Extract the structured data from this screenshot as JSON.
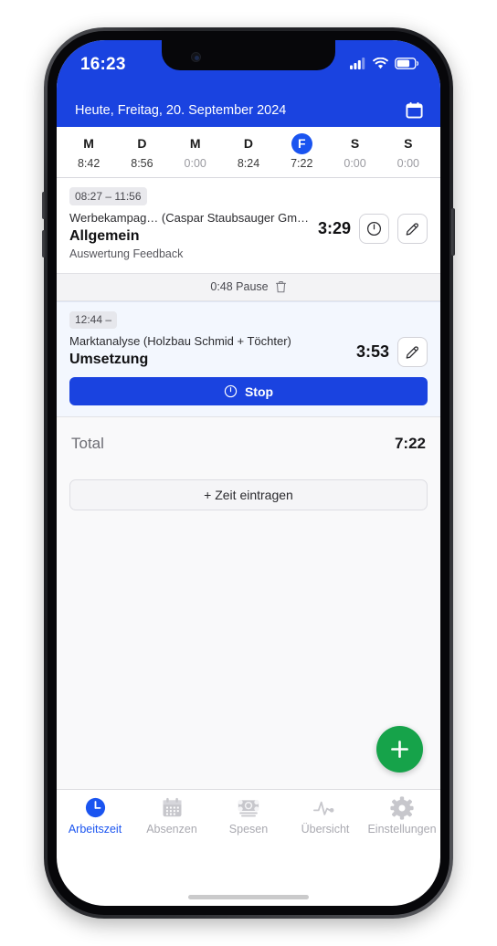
{
  "status_bar": {
    "time": "16:23",
    "icons": [
      "cellular-signal-icon",
      "wifi-icon",
      "battery-icon"
    ]
  },
  "header": {
    "title": "Heute, Freitag, 20. September 2024",
    "calendar_icon": "calendar-icon"
  },
  "week_strip": {
    "days": [
      {
        "letter": "M",
        "hours": "8:42",
        "active": false,
        "zero": false
      },
      {
        "letter": "D",
        "hours": "8:56",
        "active": false,
        "zero": false
      },
      {
        "letter": "M",
        "hours": "0:00",
        "active": false,
        "zero": true
      },
      {
        "letter": "D",
        "hours": "8:24",
        "active": false,
        "zero": false
      },
      {
        "letter": "F",
        "hours": "7:22",
        "active": true,
        "zero": false
      },
      {
        "letter": "S",
        "hours": "0:00",
        "active": false,
        "zero": true
      },
      {
        "letter": "S",
        "hours": "0:00",
        "active": false,
        "zero": true
      }
    ]
  },
  "entries": [
    {
      "time_range": "08:27 – 11:56",
      "project": "Werbekampag… (Caspar Staubsauger Gm…",
      "task": "Allgemein",
      "note": "Auswertung Feedback",
      "duration": "3:29",
      "running": false,
      "actions": [
        "timer-icon",
        "edit-pencil-icon"
      ]
    },
    {
      "time_range": "12:44 –",
      "project": "Marktanalyse (Holzbau Schmid + Töchter)",
      "task": "Umsetzung",
      "note": "",
      "duration": "3:53",
      "running": true,
      "actions": [
        "edit-pencil-icon"
      ],
      "stop_label": "Stop"
    }
  ],
  "pause": {
    "label": "0:48 Pause",
    "delete_icon": "trash-icon"
  },
  "total": {
    "label": "Total",
    "value": "7:22"
  },
  "add_time": {
    "label": "+ Zeit eintragen"
  },
  "fab": {
    "icon": "plus-icon"
  },
  "tabs": [
    {
      "label": "Arbeitszeit",
      "icon": "clock-icon",
      "active": true
    },
    {
      "label": "Absenzen",
      "icon": "calendar-icon",
      "active": false
    },
    {
      "label": "Spesen",
      "icon": "money-icon",
      "active": false
    },
    {
      "label": "Übersicht",
      "icon": "pulse-icon",
      "active": false
    },
    {
      "label": "Einstellungen",
      "icon": "gear-icon",
      "active": false
    }
  ],
  "colors": {
    "brand_blue": "#1a43e0",
    "accent_blue": "#1a54f0",
    "fab_green": "#16a34a",
    "screen_bg": "#f9f9fa"
  }
}
